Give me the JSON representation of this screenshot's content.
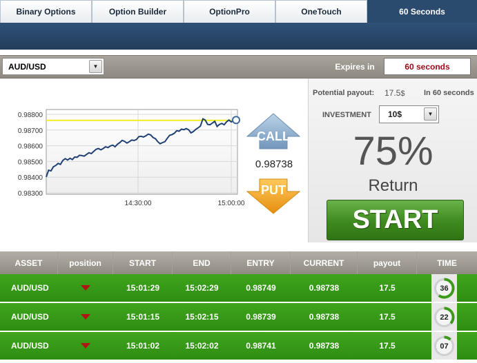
{
  "tabs": [
    {
      "label": "Binary Options",
      "active": false
    },
    {
      "label": "Option Builder",
      "active": false
    },
    {
      "label": "OptionPro",
      "active": false
    },
    {
      "label": "OneTouch",
      "active": false
    },
    {
      "label": "60 Seconds",
      "active": true
    }
  ],
  "asset": {
    "selected": "AUD/USD"
  },
  "expires": {
    "label": "Expires in",
    "value": "60 seconds"
  },
  "chart_data": {
    "type": "line",
    "y_ticks": [
      "0.98800",
      "0.98700",
      "0.98600",
      "0.98500",
      "0.98400",
      "0.98300"
    ],
    "x_ticks": [
      "14:30:00",
      "15:00:00"
    ],
    "ylim": [
      0.983,
      0.988
    ],
    "strike_level": 0.98736,
    "series": [
      {
        "values": [
          0.98402,
          0.98442,
          0.98438,
          0.98462,
          0.9847,
          0.98482,
          0.98476,
          0.985,
          0.9851,
          0.98502,
          0.98512,
          0.98505,
          0.9852,
          0.98518,
          0.9853,
          0.98528,
          0.98525,
          0.98535,
          0.98545,
          0.9854,
          0.98553,
          0.98565,
          0.9857,
          0.98562,
          0.9857,
          0.9858,
          0.98575,
          0.98585,
          0.9859,
          0.9858,
          0.98595,
          0.98605,
          0.98618,
          0.98612,
          0.98602,
          0.9861,
          0.9862,
          0.98617,
          0.98623,
          0.9864,
          0.98642,
          0.98638,
          0.98645,
          0.98655,
          0.9865,
          0.98635,
          0.98628,
          0.9861,
          0.98598,
          0.98605,
          0.9861,
          0.9863,
          0.98648,
          0.98652,
          0.9866,
          0.98675,
          0.98672,
          0.98684,
          0.98681,
          0.98688,
          0.9868,
          0.98662,
          0.9867,
          0.98683,
          0.98692,
          0.98703,
          0.98745,
          0.98738,
          0.98712,
          0.9871,
          0.9872,
          0.9873,
          0.987,
          0.98712,
          0.98718,
          0.9871,
          0.98728,
          0.98738,
          0.98727,
          0.98735,
          0.98738
        ]
      }
    ]
  },
  "current_price": "0.98738",
  "trade_buttons": {
    "call": "CALL",
    "put": "PUT"
  },
  "payout": {
    "label": "Potential payout:",
    "value": "17.5",
    "currency": "$",
    "time": "In 60 seconds"
  },
  "investment": {
    "label": "INVESTMENT",
    "value": "10$"
  },
  "return_block": {
    "percent": "75%",
    "word": "Return"
  },
  "start_label": "START",
  "table": {
    "headers": [
      "ASSET",
      "position",
      "START",
      "END",
      "ENTRY",
      "CURRENT",
      "payout",
      "TIME"
    ],
    "rows": [
      {
        "asset": "AUD/USD",
        "start": "15:01:29",
        "end": "15:02:29",
        "entry": "0.98749",
        "current": "0.98738",
        "payout": "17.5",
        "time": "36",
        "progress": 0.6
      },
      {
        "asset": "AUD/USD",
        "start": "15:01:15",
        "end": "15:02:15",
        "entry": "0.98739",
        "current": "0.98738",
        "payout": "17.5",
        "time": "22",
        "progress": 0.37
      },
      {
        "asset": "AUD/USD",
        "start": "15:01:02",
        "end": "15:02:02",
        "entry": "0.98741",
        "current": "0.98738",
        "payout": "17.5",
        "time": "07",
        "progress": 0.12
      }
    ]
  },
  "colors": {
    "accent_green": "#3c9a1a",
    "header_blue": "#2a4a6e",
    "expires_red": "#9b0a16",
    "call_blue": "#7fa3c4",
    "put_orange": "#f2a321"
  }
}
